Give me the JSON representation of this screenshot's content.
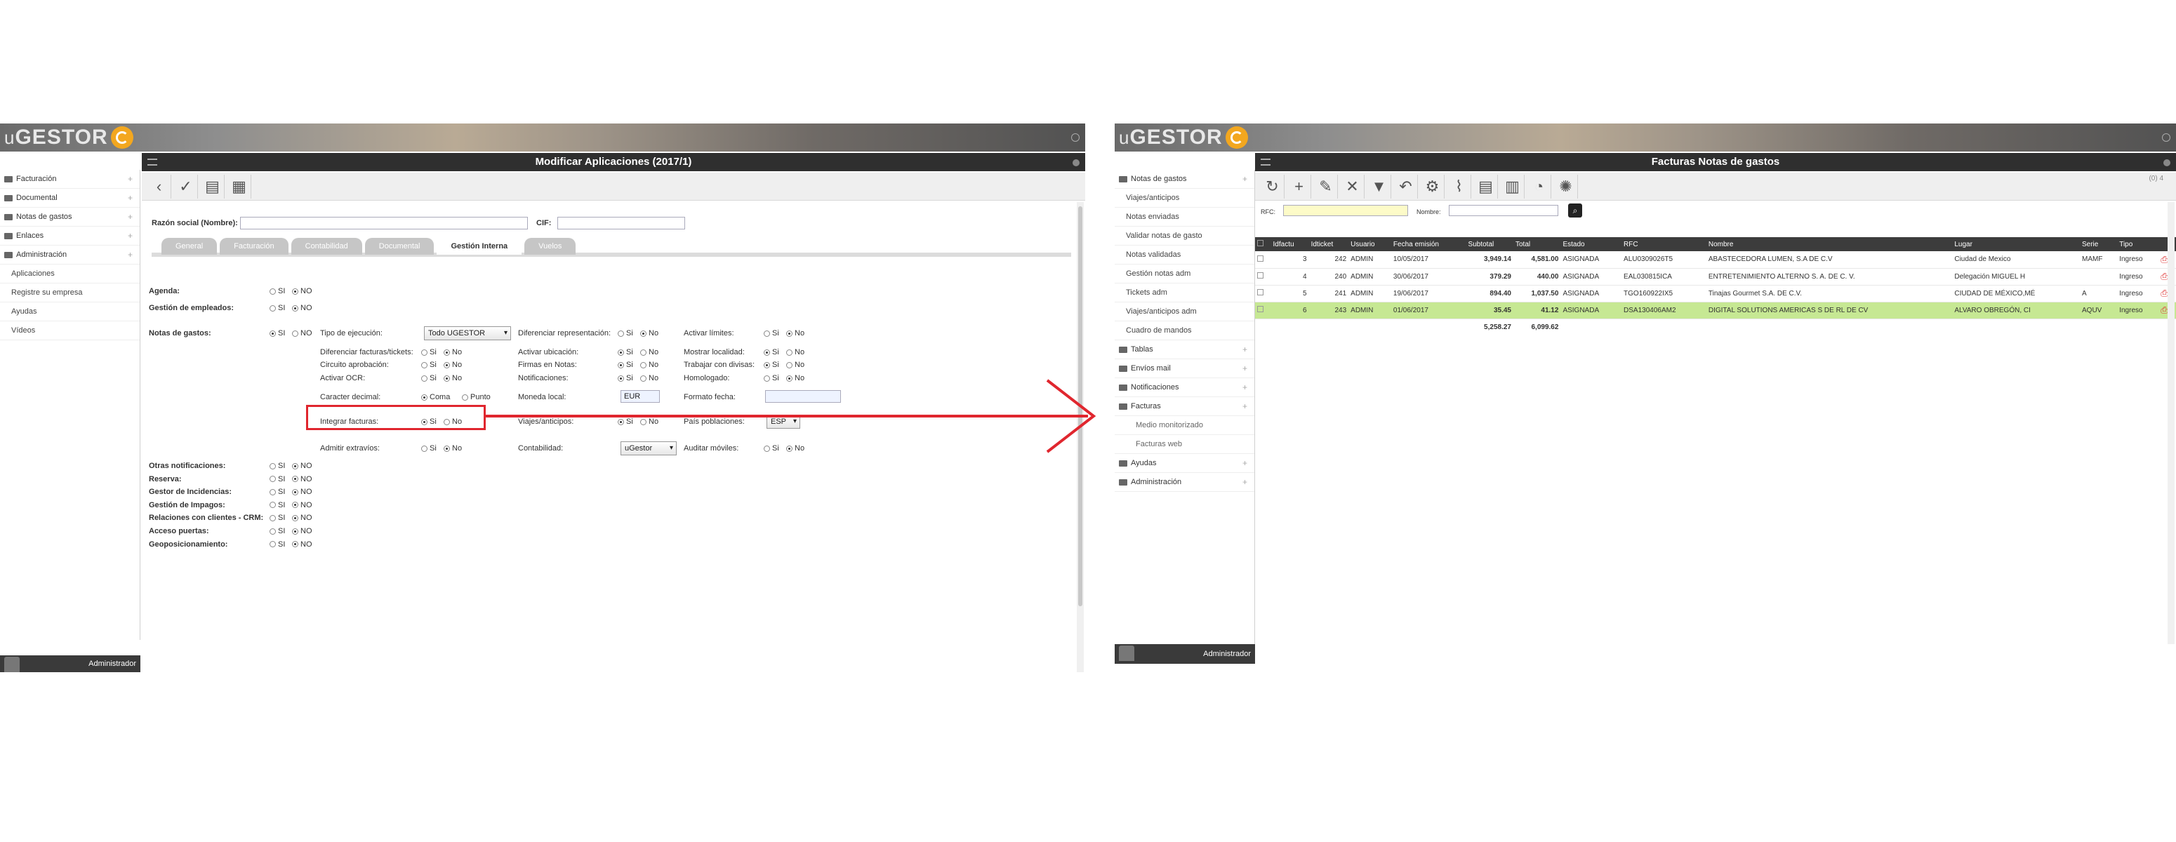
{
  "left": {
    "logo": {
      "prefix": "u",
      "name": "GESTOR"
    },
    "title": "Modificar Aplicaciones (2017/1)",
    "sidebar": [
      {
        "label": "Facturación",
        "type": "folder"
      },
      {
        "label": "Documental",
        "type": "folder"
      },
      {
        "label": "Notas de gastos",
        "type": "folder"
      },
      {
        "label": "Enlaces",
        "type": "folder"
      },
      {
        "label": "Administración",
        "type": "folder"
      },
      {
        "label": "Aplicaciones",
        "type": "sub"
      },
      {
        "label": "Registre su empresa",
        "type": "sub"
      },
      {
        "label": "Ayudas",
        "type": "sub"
      },
      {
        "label": "Vídeos",
        "type": "sub"
      }
    ],
    "user": "Administrador",
    "fields": {
      "razon_label": "Razón social (Nombre):",
      "cif_label": "CIF:"
    },
    "tabs": [
      "General",
      "Facturación",
      "Contabilidad",
      "Documental",
      "Gestión Interna",
      "Vuelos"
    ],
    "active_tab": "Gestión Interna",
    "agenda": {
      "label": "Agenda:",
      "si": "SI",
      "no": "NO"
    },
    "empleados": {
      "label": "Gestión de empleados:",
      "si": "SI",
      "no": "NO"
    },
    "notas": {
      "label": "Notas de gastos:",
      "si": "SI",
      "no": "NO"
    },
    "col1": [
      {
        "label": "Tipo de ejecución:",
        "select": "Todo UGESTOR"
      },
      {
        "label": "Diferenciar facturas/tickets:",
        "si": "Si",
        "no": "No",
        "val": "no"
      },
      {
        "label": "Circuito aprobación:",
        "si": "Si",
        "no": "No",
        "val": "no"
      },
      {
        "label": "Activar OCR:",
        "si": "Si",
        "no": "No",
        "val": "no"
      },
      {
        "label": "Caracter decimal:",
        "si": "Coma",
        "no": "Punto",
        "val": "si"
      },
      {
        "label": "Integrar facturas:",
        "si": "Si",
        "no": "No",
        "val": "si"
      },
      {
        "label": "Admitir extravíos:",
        "si": "Si",
        "no": "No",
        "val": "no"
      }
    ],
    "col2": [
      {
        "label": "Diferenciar representación:",
        "si": "Si",
        "no": "No",
        "val": "no"
      },
      {
        "label": "Activar ubicación:",
        "si": "Si",
        "no": "No",
        "val": "si"
      },
      {
        "label": "Firmas en Notas:",
        "si": "Si",
        "no": "No",
        "val": "si"
      },
      {
        "label": "Notificaciones:",
        "si": "Si",
        "no": "No",
        "val": "si"
      },
      {
        "label": "Moneda local:",
        "value": "EUR"
      },
      {
        "label": "Viajes/anticipos:",
        "si": "Si",
        "no": "No",
        "val": "si"
      },
      {
        "label": "Contabilidad:",
        "select": "uGestor"
      }
    ],
    "col3": [
      {
        "label": "Activar límites:",
        "si": "Si",
        "no": "No",
        "val": "no"
      },
      {
        "label": "Mostrar localidad:",
        "si": "Si",
        "no": "No",
        "val": "si"
      },
      {
        "label": "Trabajar con divisas:",
        "si": "Si",
        "no": "No",
        "val": "si"
      },
      {
        "label": "Homologado:",
        "si": "Si",
        "no": "No",
        "val": "no"
      },
      {
        "label": "Formato fecha:",
        "value": ""
      },
      {
        "label": "País poblaciones:",
        "select": "ESP"
      },
      {
        "label": "Auditar móviles:",
        "si": "Si",
        "no": "No",
        "val": "no"
      }
    ],
    "others": [
      {
        "label": "Otras notificaciones:",
        "si": "SI",
        "no": "NO"
      },
      {
        "label": "Reserva:",
        "si": "SI",
        "no": "NO"
      },
      {
        "label": "Gestor de Incidencias:",
        "si": "SI",
        "no": "NO"
      },
      {
        "label": "Gestión de Impagos:",
        "si": "SI",
        "no": "NO"
      },
      {
        "label": "Relaciones con clientes - CRM:",
        "si": "SI",
        "no": "NO"
      },
      {
        "label": "Acceso puertas:",
        "si": "SI",
        "no": "NO"
      },
      {
        "label": "Geoposicionamiento:",
        "si": "SI",
        "no": "NO"
      }
    ]
  },
  "right": {
    "logo": {
      "prefix": "u",
      "name": "GESTOR"
    },
    "title": "Facturas Notas de gastos",
    "sidebar": [
      {
        "label": "Notas de gastos",
        "type": "folder"
      },
      {
        "label": "Viajes/anticipos",
        "type": "sub"
      },
      {
        "label": "Notas enviadas",
        "type": "sub"
      },
      {
        "label": "Validar notas de gasto",
        "type": "sub"
      },
      {
        "label": "Notas validadas",
        "type": "sub"
      },
      {
        "label": "Gestión notas adm",
        "type": "sub"
      },
      {
        "label": "Tickets adm",
        "type": "sub"
      },
      {
        "label": "Viajes/anticipos adm",
        "type": "sub"
      },
      {
        "label": "Cuadro de mandos",
        "type": "sub"
      },
      {
        "label": "Tablas",
        "type": "folder"
      },
      {
        "label": "Envíos mail",
        "type": "folder"
      },
      {
        "label": "Notificaciones",
        "type": "folder"
      },
      {
        "label": "Facturas",
        "type": "folder"
      },
      {
        "label": "Medio monitorizado",
        "type": "sub2"
      },
      {
        "label": "Facturas web",
        "type": "sub2"
      },
      {
        "label": "Ayudas",
        "type": "folder"
      },
      {
        "label": "Administración",
        "type": "folder"
      }
    ],
    "user": "Administrador",
    "zoom": "(0) 4",
    "filter": {
      "rfc_label": "RFC:",
      "nombre_label": "Nombre:"
    },
    "columns": [
      "",
      "Idfactu",
      "Idticket",
      "Usuario",
      "Fecha emisión",
      "Subtotal",
      "Total",
      "Estado",
      "RFC",
      "Nombre",
      "Lugar",
      "Serie",
      "Tipo",
      ""
    ],
    "rows": [
      [
        "3",
        "242",
        "ADMIN",
        "10/05/2017",
        "3,949.14",
        "4,581.00",
        "ASIGNADA",
        "ALU0309026T5",
        "ABASTECEDORA LUMEN, S.A DE C.V",
        "Ciudad de Mexico",
        "MAMF",
        "Ingreso"
      ],
      [
        "4",
        "240",
        "ADMIN",
        "30/06/2017",
        "379.29",
        "440.00",
        "ASIGNADA",
        "EAL030815ICA",
        "ENTRETENIMIENTO ALTERNO S. A. DE C. V.",
        "Delegación MIGUEL H",
        "",
        "Ingreso"
      ],
      [
        "5",
        "241",
        "ADMIN",
        "19/06/2017",
        "894.40",
        "1,037.50",
        "ASIGNADA",
        "TGO160922IX5",
        "Tinajas Gourmet S.A. DE C.V.",
        "CIUDAD DE MÉXICO,MÉ",
        "A",
        "Ingreso"
      ],
      [
        "6",
        "243",
        "ADMIN",
        "01/06/2017",
        "35.45",
        "41.12",
        "ASIGNADA",
        "DSA130406AM2",
        "DIGITAL SOLUTIONS AMERICAS S DE RL DE CV",
        "ALVARO OBREGÓN, CI",
        "AQUV",
        "Ingreso"
      ]
    ],
    "totals": {
      "subtotal": "5,258.27",
      "total": "6,099.62"
    }
  }
}
